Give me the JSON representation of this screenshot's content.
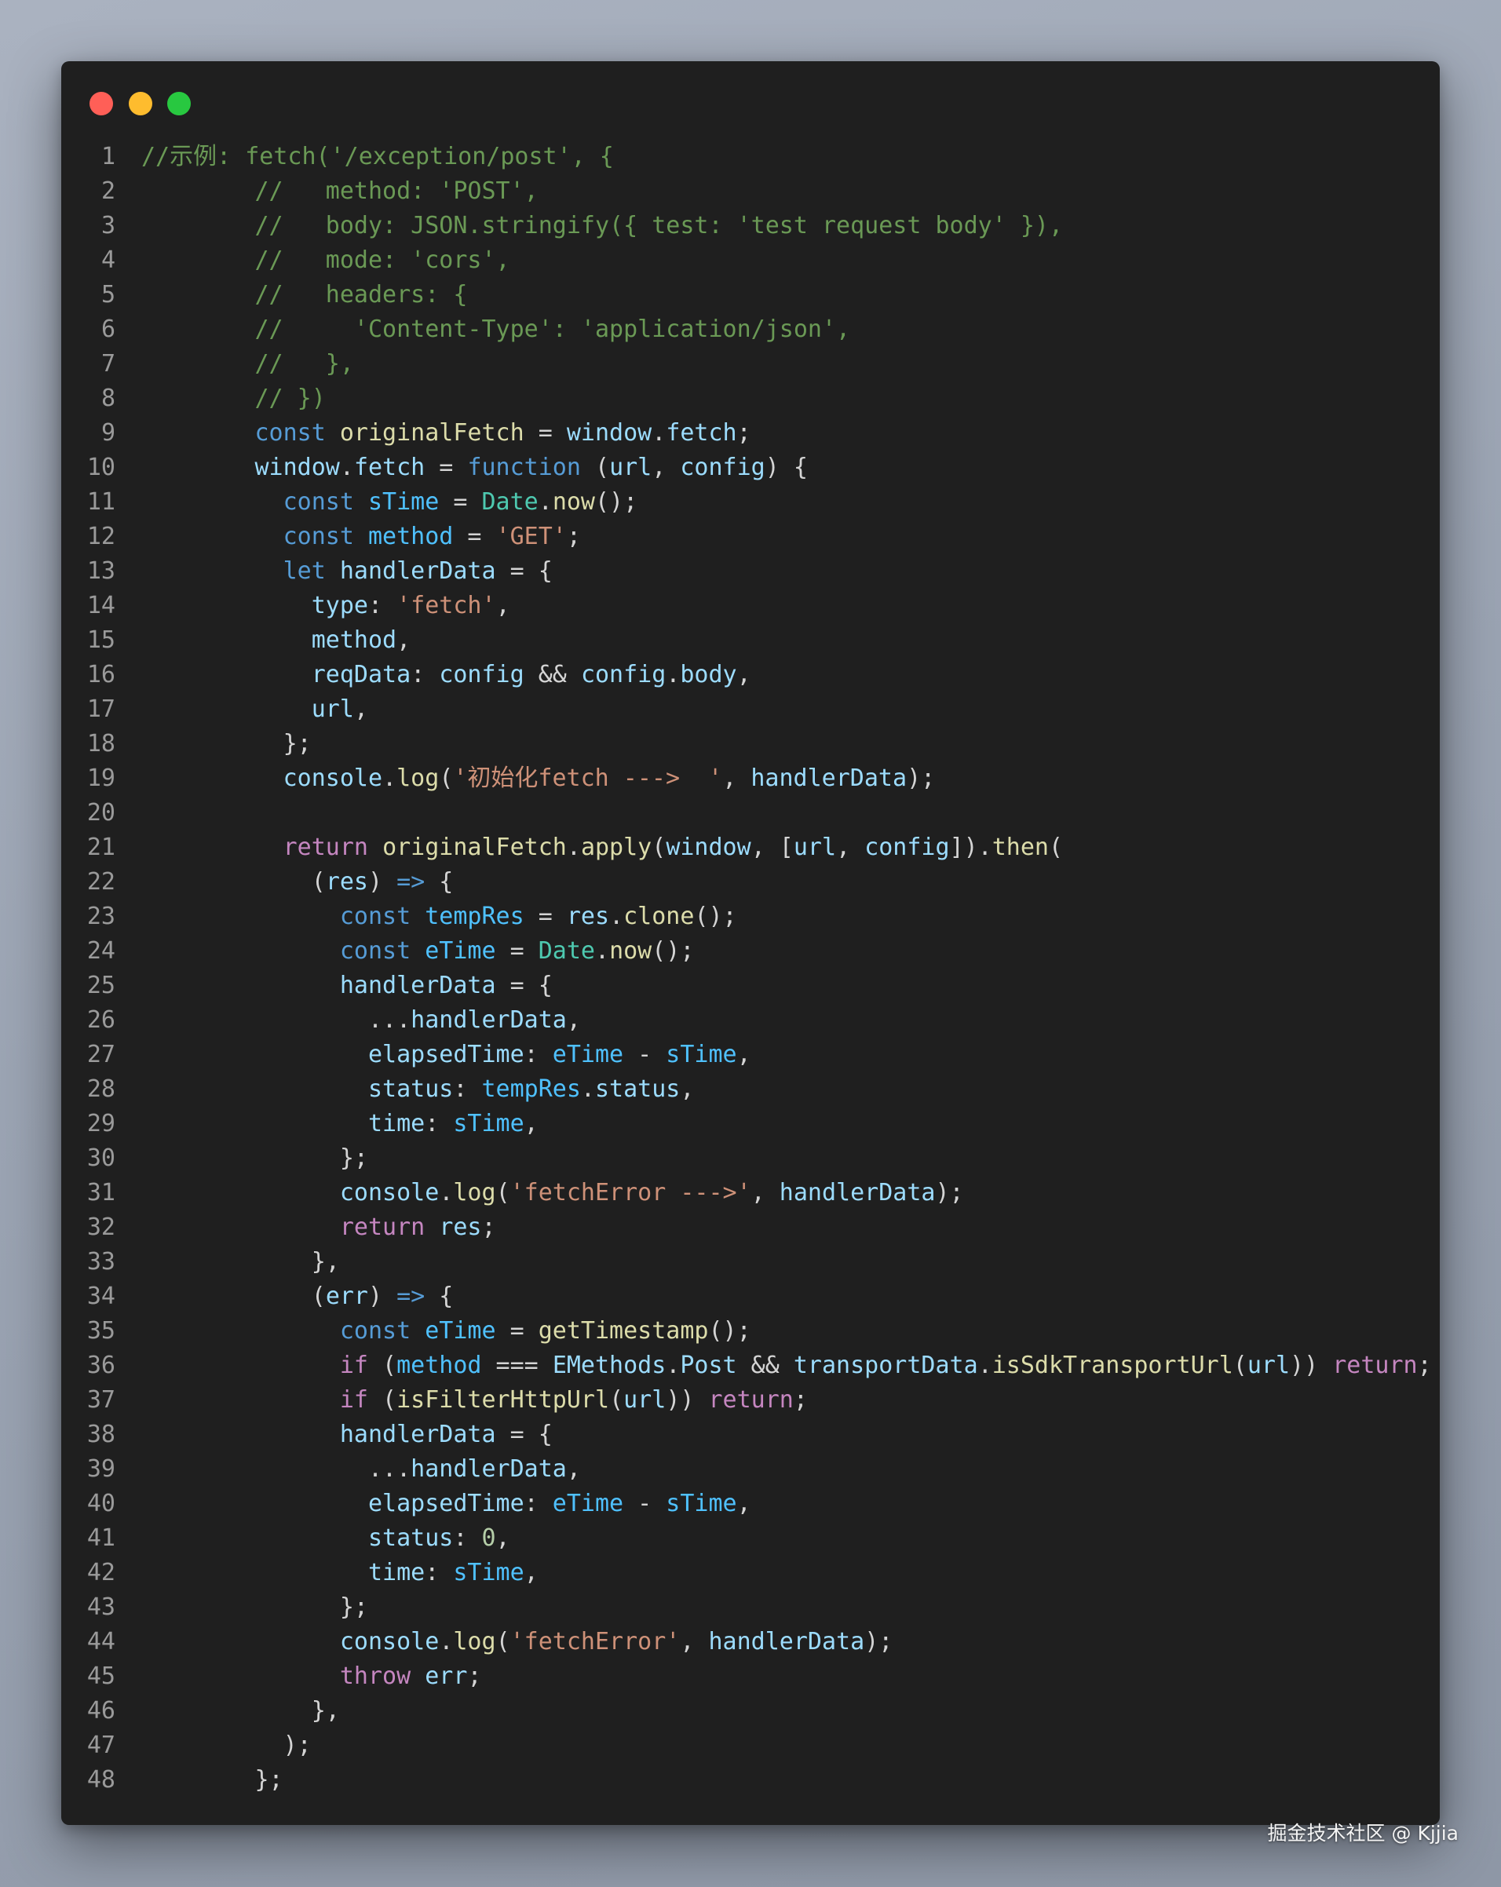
{
  "window": {
    "controls": [
      {
        "name": "close",
        "color": "#ff5f57"
      },
      {
        "name": "minimize",
        "color": "#febc2e"
      },
      {
        "name": "zoom",
        "color": "#28c840"
      }
    ]
  },
  "code": {
    "language": "javascript",
    "lines": [
      [
        [
          "cm",
          "//示例: fetch('/exception/post', {"
        ]
      ],
      [
        [
          "p",
          "        "
        ],
        [
          "cm",
          "//   method: 'POST',"
        ]
      ],
      [
        [
          "p",
          "        "
        ],
        [
          "cm",
          "//   body: JSON.stringify({ test: 'test request body' }),"
        ]
      ],
      [
        [
          "p",
          "        "
        ],
        [
          "cm",
          "//   mode: 'cors',"
        ]
      ],
      [
        [
          "p",
          "        "
        ],
        [
          "cm",
          "//   headers: {"
        ]
      ],
      [
        [
          "p",
          "        "
        ],
        [
          "cm",
          "//     'Content-Type': 'application/json',"
        ]
      ],
      [
        [
          "p",
          "        "
        ],
        [
          "cm",
          "//   },"
        ]
      ],
      [
        [
          "p",
          "        "
        ],
        [
          "cm",
          "// })"
        ]
      ],
      [
        [
          "p",
          "        "
        ],
        [
          "kw",
          "const"
        ],
        [
          "p",
          " "
        ],
        [
          "fn",
          "originalFetch"
        ],
        [
          "p",
          " = "
        ],
        [
          "var",
          "window"
        ],
        [
          "p",
          "."
        ],
        [
          "var",
          "fetch"
        ],
        [
          "p",
          ";"
        ]
      ],
      [
        [
          "p",
          "        "
        ],
        [
          "var",
          "window"
        ],
        [
          "p",
          "."
        ],
        [
          "var",
          "fetch"
        ],
        [
          "p",
          " = "
        ],
        [
          "kw",
          "function"
        ],
        [
          "p",
          " ("
        ],
        [
          "var",
          "url"
        ],
        [
          "p",
          ", "
        ],
        [
          "var",
          "config"
        ],
        [
          "p",
          ") {"
        ]
      ],
      [
        [
          "p",
          "          "
        ],
        [
          "kw",
          "const"
        ],
        [
          "p",
          " "
        ],
        [
          "cst",
          "sTime"
        ],
        [
          "p",
          " = "
        ],
        [
          "cls",
          "Date"
        ],
        [
          "p",
          "."
        ],
        [
          "fn",
          "now"
        ],
        [
          "p",
          "();"
        ]
      ],
      [
        [
          "p",
          "          "
        ],
        [
          "kw",
          "const"
        ],
        [
          "p",
          " "
        ],
        [
          "cst",
          "method"
        ],
        [
          "p",
          " = "
        ],
        [
          "str",
          "'GET'"
        ],
        [
          "p",
          ";"
        ]
      ],
      [
        [
          "p",
          "          "
        ],
        [
          "kw",
          "let"
        ],
        [
          "p",
          " "
        ],
        [
          "var",
          "handlerData"
        ],
        [
          "p",
          " = {"
        ]
      ],
      [
        [
          "p",
          "            "
        ],
        [
          "var",
          "type"
        ],
        [
          "p",
          ": "
        ],
        [
          "str",
          "'fetch'"
        ],
        [
          "p",
          ","
        ]
      ],
      [
        [
          "p",
          "            "
        ],
        [
          "var",
          "method"
        ],
        [
          "p",
          ","
        ]
      ],
      [
        [
          "p",
          "            "
        ],
        [
          "var",
          "reqData"
        ],
        [
          "p",
          ": "
        ],
        [
          "var",
          "config"
        ],
        [
          "p",
          " && "
        ],
        [
          "var",
          "config"
        ],
        [
          "p",
          "."
        ],
        [
          "var",
          "body"
        ],
        [
          "p",
          ","
        ]
      ],
      [
        [
          "p",
          "            "
        ],
        [
          "var",
          "url"
        ],
        [
          "p",
          ","
        ]
      ],
      [
        [
          "p",
          "          };"
        ]
      ],
      [
        [
          "p",
          "          "
        ],
        [
          "var",
          "console"
        ],
        [
          "p",
          "."
        ],
        [
          "fn",
          "log"
        ],
        [
          "p",
          "("
        ],
        [
          "str",
          "'初始化fetch --->  '"
        ],
        [
          "p",
          ", "
        ],
        [
          "var",
          "handlerData"
        ],
        [
          "p",
          ");"
        ]
      ],
      [
        [
          "p",
          ""
        ]
      ],
      [
        [
          "p",
          "          "
        ],
        [
          "ctl",
          "return"
        ],
        [
          "p",
          " "
        ],
        [
          "fn",
          "originalFetch"
        ],
        [
          "p",
          "."
        ],
        [
          "fn",
          "apply"
        ],
        [
          "p",
          "("
        ],
        [
          "var",
          "window"
        ],
        [
          "p",
          ", ["
        ],
        [
          "var",
          "url"
        ],
        [
          "p",
          ", "
        ],
        [
          "var",
          "config"
        ],
        [
          "p",
          "])."
        ],
        [
          "fn",
          "then"
        ],
        [
          "p",
          "("
        ]
      ],
      [
        [
          "p",
          "            ("
        ],
        [
          "var",
          "res"
        ],
        [
          "p",
          ") "
        ],
        [
          "kw",
          "=>"
        ],
        [
          "p",
          " {"
        ]
      ],
      [
        [
          "p",
          "              "
        ],
        [
          "kw",
          "const"
        ],
        [
          "p",
          " "
        ],
        [
          "cst",
          "tempRes"
        ],
        [
          "p",
          " = "
        ],
        [
          "var",
          "res"
        ],
        [
          "p",
          "."
        ],
        [
          "fn",
          "clone"
        ],
        [
          "p",
          "();"
        ]
      ],
      [
        [
          "p",
          "              "
        ],
        [
          "kw",
          "const"
        ],
        [
          "p",
          " "
        ],
        [
          "cst",
          "eTime"
        ],
        [
          "p",
          " = "
        ],
        [
          "cls",
          "Date"
        ],
        [
          "p",
          "."
        ],
        [
          "fn",
          "now"
        ],
        [
          "p",
          "();"
        ]
      ],
      [
        [
          "p",
          "              "
        ],
        [
          "var",
          "handlerData"
        ],
        [
          "p",
          " = {"
        ]
      ],
      [
        [
          "p",
          "                ..."
        ],
        [
          "var",
          "handlerData"
        ],
        [
          "p",
          ","
        ]
      ],
      [
        [
          "p",
          "                "
        ],
        [
          "var",
          "elapsedTime"
        ],
        [
          "p",
          ": "
        ],
        [
          "cst",
          "eTime"
        ],
        [
          "p",
          " - "
        ],
        [
          "cst",
          "sTime"
        ],
        [
          "p",
          ","
        ]
      ],
      [
        [
          "p",
          "                "
        ],
        [
          "var",
          "status"
        ],
        [
          "p",
          ": "
        ],
        [
          "cst",
          "tempRes"
        ],
        [
          "p",
          "."
        ],
        [
          "var",
          "status"
        ],
        [
          "p",
          ","
        ]
      ],
      [
        [
          "p",
          "                "
        ],
        [
          "var",
          "time"
        ],
        [
          "p",
          ": "
        ],
        [
          "cst",
          "sTime"
        ],
        [
          "p",
          ","
        ]
      ],
      [
        [
          "p",
          "              };"
        ]
      ],
      [
        [
          "p",
          "              "
        ],
        [
          "var",
          "console"
        ],
        [
          "p",
          "."
        ],
        [
          "fn",
          "log"
        ],
        [
          "p",
          "("
        ],
        [
          "str",
          "'fetchError --->'"
        ],
        [
          "p",
          ", "
        ],
        [
          "var",
          "handlerData"
        ],
        [
          "p",
          ");"
        ]
      ],
      [
        [
          "p",
          "              "
        ],
        [
          "ctl",
          "return"
        ],
        [
          "p",
          " "
        ],
        [
          "var",
          "res"
        ],
        [
          "p",
          ";"
        ]
      ],
      [
        [
          "p",
          "            },"
        ]
      ],
      [
        [
          "p",
          "            ("
        ],
        [
          "var",
          "err"
        ],
        [
          "p",
          ") "
        ],
        [
          "kw",
          "=>"
        ],
        [
          "p",
          " {"
        ]
      ],
      [
        [
          "p",
          "              "
        ],
        [
          "kw",
          "const"
        ],
        [
          "p",
          " "
        ],
        [
          "cst",
          "eTime"
        ],
        [
          "p",
          " = "
        ],
        [
          "fn",
          "getTimestamp"
        ],
        [
          "p",
          "();"
        ]
      ],
      [
        [
          "p",
          "              "
        ],
        [
          "ctl",
          "if"
        ],
        [
          "p",
          " ("
        ],
        [
          "cst",
          "method"
        ],
        [
          "p",
          " === "
        ],
        [
          "var",
          "EMethods"
        ],
        [
          "p",
          "."
        ],
        [
          "var",
          "Post"
        ],
        [
          "p",
          " && "
        ],
        [
          "var",
          "transportData"
        ],
        [
          "p",
          "."
        ],
        [
          "fn",
          "isSdkTransportUrl"
        ],
        [
          "p",
          "("
        ],
        [
          "var",
          "url"
        ],
        [
          "p",
          ")) "
        ],
        [
          "ctl",
          "return"
        ],
        [
          "p",
          ";"
        ]
      ],
      [
        [
          "p",
          "              "
        ],
        [
          "ctl",
          "if"
        ],
        [
          "p",
          " ("
        ],
        [
          "fn",
          "isFilterHttpUrl"
        ],
        [
          "p",
          "("
        ],
        [
          "var",
          "url"
        ],
        [
          "p",
          ")) "
        ],
        [
          "ctl",
          "return"
        ],
        [
          "p",
          ";"
        ]
      ],
      [
        [
          "p",
          "              "
        ],
        [
          "var",
          "handlerData"
        ],
        [
          "p",
          " = {"
        ]
      ],
      [
        [
          "p",
          "                ..."
        ],
        [
          "var",
          "handlerData"
        ],
        [
          "p",
          ","
        ]
      ],
      [
        [
          "p",
          "                "
        ],
        [
          "var",
          "elapsedTime"
        ],
        [
          "p",
          ": "
        ],
        [
          "cst",
          "eTime"
        ],
        [
          "p",
          " - "
        ],
        [
          "cst",
          "sTime"
        ],
        [
          "p",
          ","
        ]
      ],
      [
        [
          "p",
          "                "
        ],
        [
          "var",
          "status"
        ],
        [
          "p",
          ": "
        ],
        [
          "num",
          "0"
        ],
        [
          "p",
          ","
        ]
      ],
      [
        [
          "p",
          "                "
        ],
        [
          "var",
          "time"
        ],
        [
          "p",
          ": "
        ],
        [
          "cst",
          "sTime"
        ],
        [
          "p",
          ","
        ]
      ],
      [
        [
          "p",
          "              };"
        ]
      ],
      [
        [
          "p",
          "              "
        ],
        [
          "var",
          "console"
        ],
        [
          "p",
          "."
        ],
        [
          "fn",
          "log"
        ],
        [
          "p",
          "("
        ],
        [
          "str",
          "'fetchError'"
        ],
        [
          "p",
          ", "
        ],
        [
          "var",
          "handlerData"
        ],
        [
          "p",
          ");"
        ]
      ],
      [
        [
          "p",
          "              "
        ],
        [
          "ctl",
          "throw"
        ],
        [
          "p",
          " "
        ],
        [
          "var",
          "err"
        ],
        [
          "p",
          ";"
        ]
      ],
      [
        [
          "p",
          "            },"
        ]
      ],
      [
        [
          "p",
          "          );"
        ]
      ],
      [
        [
          "p",
          "        };"
        ]
      ]
    ]
  },
  "watermark": "掘金技术社区 @ Kjjia"
}
